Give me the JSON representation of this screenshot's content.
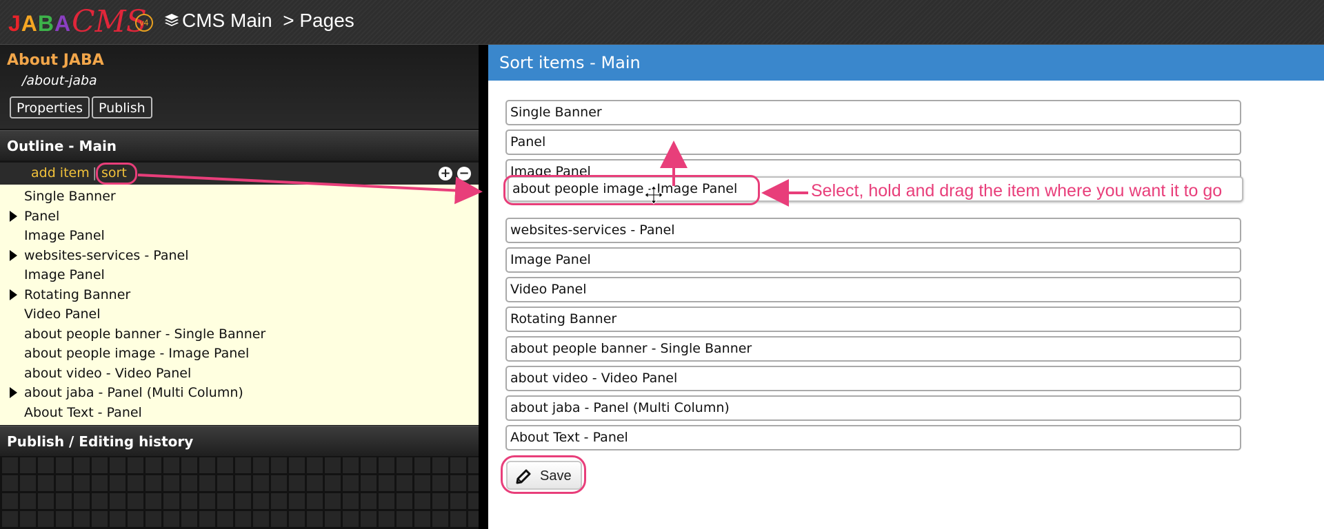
{
  "app": {
    "logo_main": "JABA",
    "logo_script": "CMS",
    "logo_version": "v4",
    "breadcrumb": "CMS Main  > Pages",
    "breadcrumb_icon": "stack-icon"
  },
  "page": {
    "title": "About JABA",
    "url": "/about-jaba",
    "properties_label": "Properties",
    "publish_label": "Publish"
  },
  "outline": {
    "title": "Outline - Main",
    "add_item_label": "add item",
    "separator": "|",
    "sort_label": "sort",
    "items": [
      {
        "label": "Single Banner",
        "expandable": false
      },
      {
        "label": "Panel",
        "expandable": true
      },
      {
        "label": "Image Panel",
        "expandable": false
      },
      {
        "label": "websites-services - Panel",
        "expandable": true
      },
      {
        "label": "Image Panel",
        "expandable": false
      },
      {
        "label": "Rotating Banner",
        "expandable": true
      },
      {
        "label": "Video Panel",
        "expandable": false
      },
      {
        "label": "about people banner - Single Banner",
        "expandable": false
      },
      {
        "label": "about people image - Image Panel",
        "expandable": false
      },
      {
        "label": "about video - Video Panel",
        "expandable": false
      },
      {
        "label": "about jaba - Panel (Multi Column)",
        "expandable": true
      },
      {
        "label": "About Text - Panel",
        "expandable": false
      }
    ]
  },
  "history": {
    "title": "Publish / Editing history"
  },
  "sort_panel": {
    "title": "Sort items - Main",
    "items": [
      "Single Banner",
      "Panel",
      "Image Panel",
      "websites-services - Panel",
      "Image Panel",
      "Video Panel",
      "Rotating Banner",
      "about people banner - Single Banner",
      "about video - Video Panel",
      "about jaba - Panel (Multi Column)",
      "About Text - Panel"
    ],
    "dragging_item": "about people image - Image Panel",
    "save_label": "Save"
  },
  "annotation": {
    "text": "Select, hold and drag the item where you want it to go",
    "color": "#e83e7a"
  },
  "colors": {
    "accent_orange": "#f2a64a",
    "link_yellow": "#f2c23a",
    "header_blue": "#3a87cc",
    "outline_bg": "#ffffe0"
  }
}
